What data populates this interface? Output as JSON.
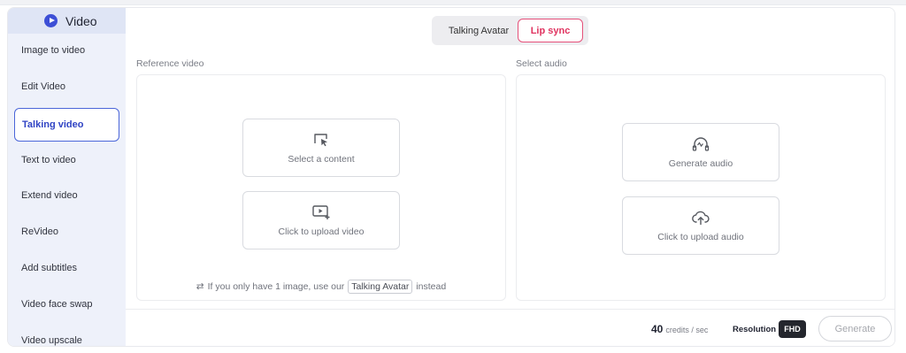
{
  "sidebar": {
    "header": {
      "title": "Video"
    },
    "items": [
      {
        "label": "Image to video"
      },
      {
        "label": "Edit Video"
      },
      {
        "label": "Talking video"
      },
      {
        "label": "Text to video"
      },
      {
        "label": "Extend video"
      },
      {
        "label": "ReVideo"
      },
      {
        "label": "Add subtitles"
      },
      {
        "label": "Video face swap"
      },
      {
        "label": "Video upscale"
      }
    ],
    "active_index": 2
  },
  "mode_toggle": {
    "options": [
      "Talking Avatar",
      "Lip sync"
    ],
    "selected": "Lip sync"
  },
  "reference": {
    "label": "Reference video",
    "select_content": "Select a content",
    "upload_video": "Click to upload video",
    "hint_before": "If you only have 1 image, use our",
    "hint_link": "Talking Avatar",
    "hint_after": "instead"
  },
  "audio": {
    "label": "Select audio",
    "generate_audio": "Generate audio",
    "upload_audio": "Click to upload audio"
  },
  "footer": {
    "credits_value": "40",
    "credits_unit": "credits / sec",
    "resolution_label": "Resolution",
    "resolution_value": "FHD",
    "generate_label": "Generate"
  },
  "colors": {
    "accent_blue": "#3d4fd6",
    "lip_sync_pink": "#e0325f",
    "sidebar_bg": "#eef1fa"
  }
}
